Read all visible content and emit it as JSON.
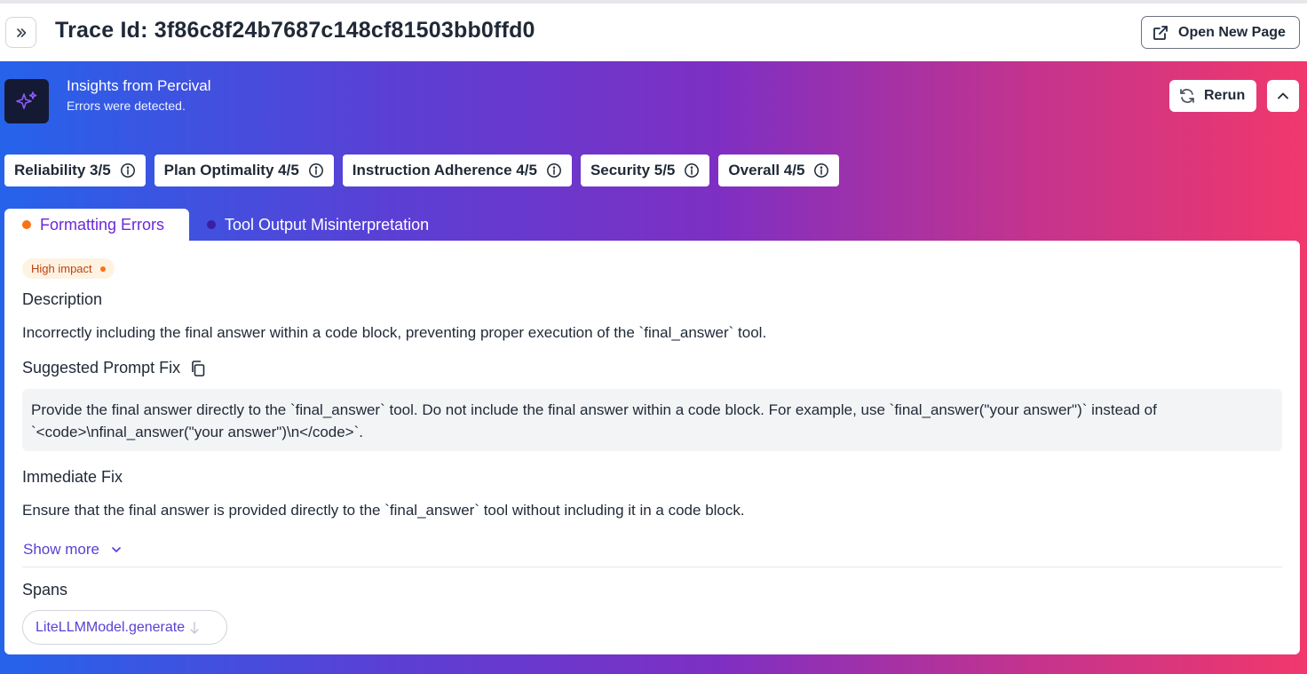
{
  "header": {
    "title": "Trace Id: 3f86c8f24b7687c148cf81503bb0ffd0",
    "open_new_page_label": "Open New Page"
  },
  "insights": {
    "title": "Insights from Percival",
    "subtitle": "Errors were detected.",
    "rerun_label": "Rerun"
  },
  "scores": [
    {
      "label": "Reliability 3/5"
    },
    {
      "label": "Plan Optimality 4/5"
    },
    {
      "label": "Instruction Adherence 4/5"
    },
    {
      "label": "Security 5/5"
    },
    {
      "label": "Overall 4/5"
    }
  ],
  "tabs": [
    {
      "label": "Formatting Errors",
      "active": true,
      "dot_color": "#f97316"
    },
    {
      "label": "Tool Output Misinterpretation",
      "active": false,
      "dot_color": "#3b1fa0"
    }
  ],
  "panel": {
    "impact_badge": "High impact",
    "description_heading": "Description",
    "description_text": "Incorrectly including the final answer within a code block, preventing proper execution of the `final_answer` tool.",
    "prompt_fix_heading": "Suggested Prompt Fix",
    "prompt_fix_text": "Provide the final answer directly to the `final_answer` tool. Do not include the final answer within a code block. For example, use `final_answer(\"your answer\")` instead of `<code>\\nfinal_answer(\"your answer\")\\n</code>`.",
    "immediate_fix_heading": "Immediate Fix",
    "immediate_fix_text": "Ensure that the final answer is provided directly to the `final_answer` tool without including it in a code block.",
    "show_more_label": "Show more",
    "spans_heading": "Spans",
    "span_chip_label": "LiteLLMModel.generate"
  },
  "colors": {
    "accent": "#5b3fd4",
    "impact": "#f97316",
    "gradient_start": "#2563eb",
    "gradient_end": "#f0386c"
  }
}
